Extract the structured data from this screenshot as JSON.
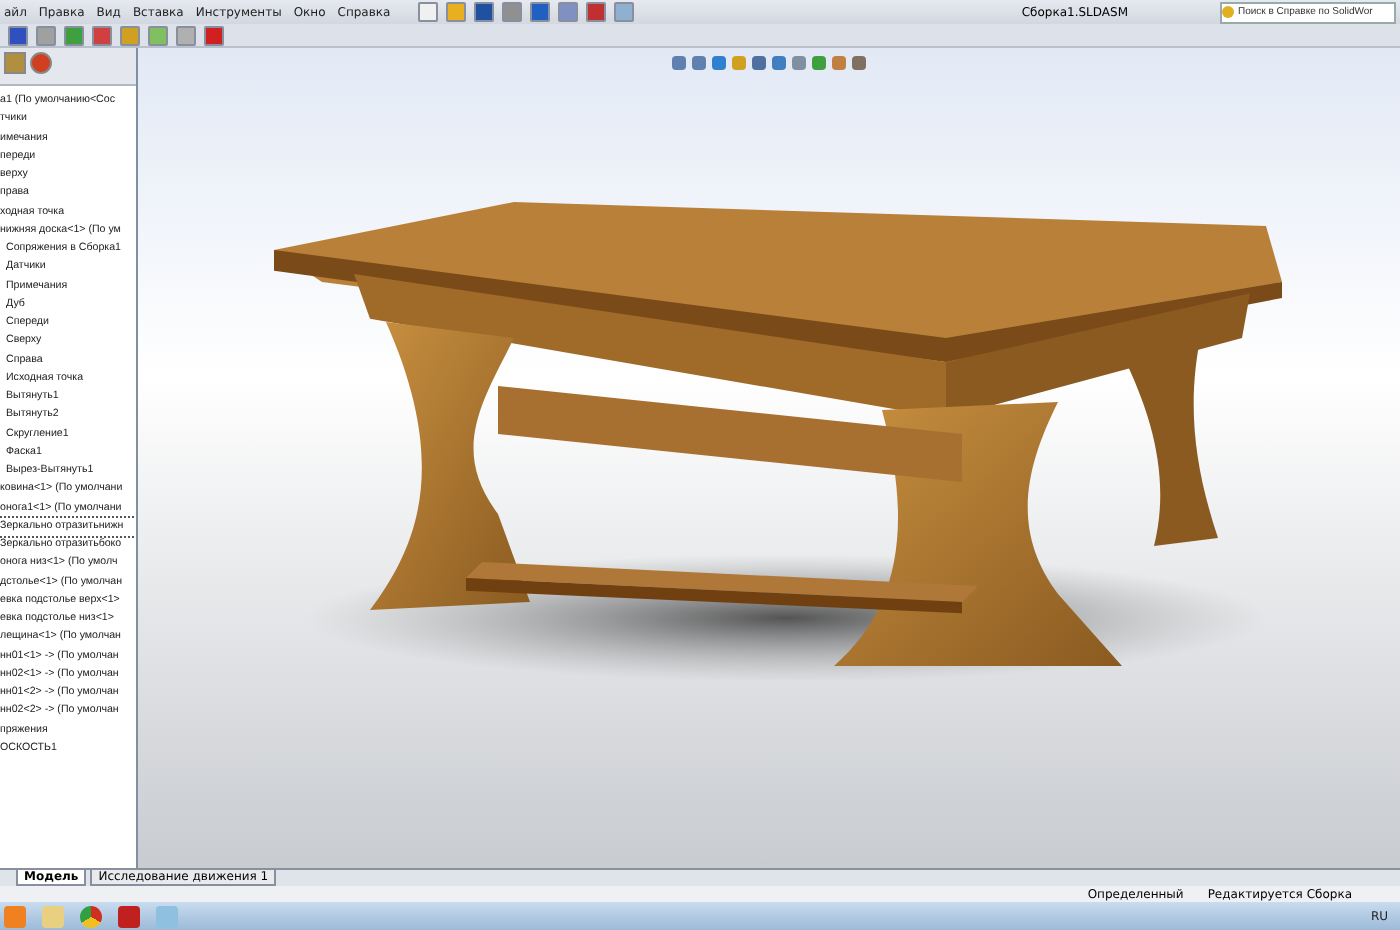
{
  "menu": [
    "айл",
    "Правка",
    "Вид",
    "Вставка",
    "Инструменты",
    "Окно",
    "Справка"
  ],
  "window": {
    "title": "Сборка1.SLDASM"
  },
  "search": {
    "placeholder": "Поиск в Справке по SolidWor"
  },
  "tree": [
    {
      "label": "а1  (По умолчанию<Сос",
      "selected": false
    },
    {
      "label": "тчики",
      "selected": false
    },
    {
      "label": "имечания",
      "selected": false
    },
    {
      "label": "переди",
      "selected": false
    },
    {
      "label": "верху",
      "selected": false
    },
    {
      "label": "права",
      "selected": false
    },
    {
      "label": "ходная точка",
      "selected": false
    },
    {
      "label": "нижняя доска<1> (По ум",
      "selected": false,
      "children": [
        {
          "label": "Сопряжения в Сборка1",
          "selected": false
        },
        {
          "label": "Датчики",
          "selected": false
        },
        {
          "label": "Примечания",
          "selected": false
        },
        {
          "label": "Дуб",
          "selected": false
        },
        {
          "label": "Спереди",
          "selected": false
        },
        {
          "label": "Сверху",
          "selected": false
        },
        {
          "label": "Справа",
          "selected": false
        },
        {
          "label": "Исходная точка",
          "selected": false
        },
        {
          "label": "Вытянуть1",
          "selected": false
        },
        {
          "label": "Вытянуть2",
          "selected": false
        },
        {
          "label": "Скругление1",
          "selected": false
        },
        {
          "label": "Фаска1",
          "selected": false
        },
        {
          "label": "Вырез-Вытянуть1",
          "selected": false
        }
      ]
    },
    {
      "label": "ковина<1> (По умолчани",
      "selected": false
    },
    {
      "label": "онога1<1> (По умолчани",
      "selected": false
    },
    {
      "label": "Зеркально отразитьнижн",
      "selected": true
    },
    {
      "label": "Зеркально отразитьбоко",
      "selected": false
    },
    {
      "label": "онога низ<1> (По умолч",
      "selected": false
    },
    {
      "label": "дстолье<1> (По умолчан",
      "selected": false
    },
    {
      "label": "евка подстолье верх<1>",
      "selected": false
    },
    {
      "label": "евка подстолье низ<1>",
      "selected": false
    },
    {
      "label": "лещина<1> (По умолчан",
      "selected": false
    },
    {
      "label": "нн01<1> -> (По умолчан",
      "selected": false
    },
    {
      "label": "нн02<1> -> (По умолчан",
      "selected": false
    },
    {
      "label": "нн01<2> -> (По умолчан",
      "selected": false
    },
    {
      "label": "нн02<2> -> (По умолчан",
      "selected": false
    },
    {
      "label": "пряжения",
      "selected": false
    },
    {
      "label": "ОСКОСТЬ1",
      "selected": false
    }
  ],
  "bottom_tabs": [
    {
      "label": "Модель",
      "selected": true
    },
    {
      "label": "Исследование движения 1",
      "selected": false
    }
  ],
  "status_bar": [
    "Определенный",
    "Редактируется Сборка"
  ],
  "taskbar": {
    "language": "RU"
  }
}
